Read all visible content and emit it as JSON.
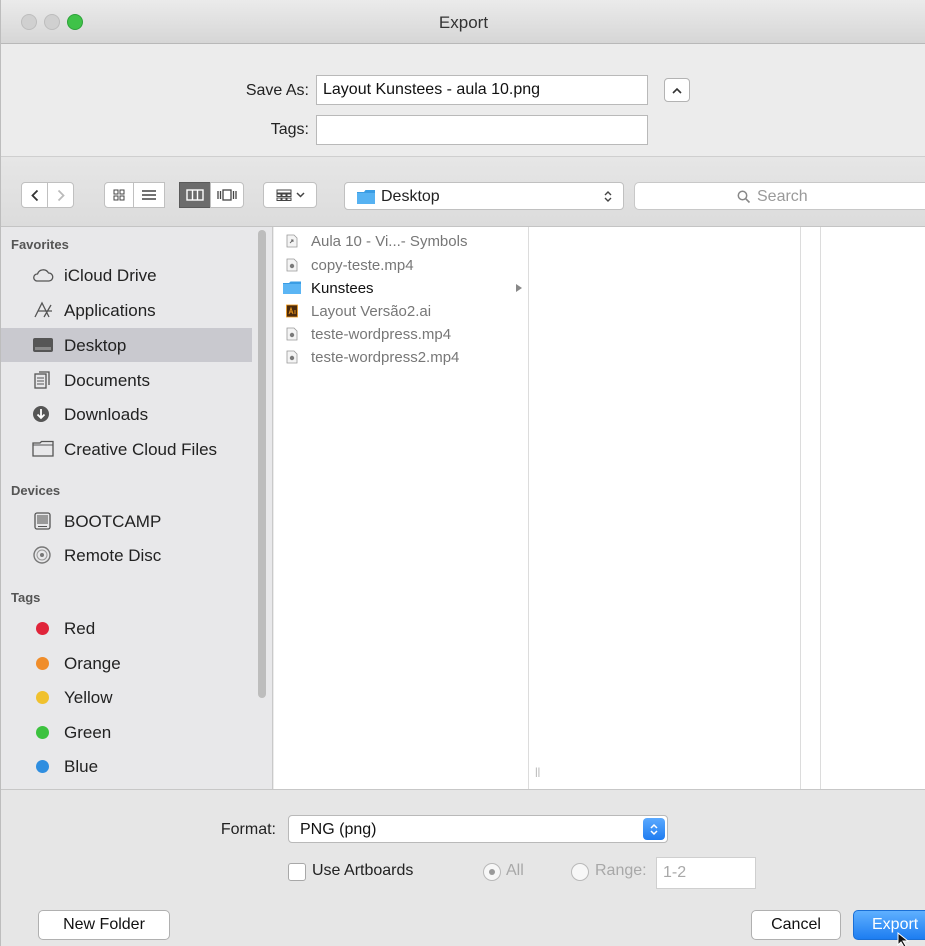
{
  "window": {
    "title": "Export"
  },
  "saveas": {
    "save_as_label": "Save As:",
    "file_name": "Layout Kunstees - aula 10.png",
    "tags_label": "Tags:",
    "tags_value": ""
  },
  "toolbar": {
    "location": "Desktop",
    "search_placeholder": "Search"
  },
  "sidebar": {
    "favorites_header": "Favorites",
    "favorites": [
      {
        "label": "iCloud Drive",
        "icon": "cloud-icon"
      },
      {
        "label": "Applications",
        "icon": "applications-icon"
      },
      {
        "label": "Desktop",
        "icon": "desktop-icon",
        "selected": true
      },
      {
        "label": "Documents",
        "icon": "documents-icon"
      },
      {
        "label": "Downloads",
        "icon": "downloads-icon"
      },
      {
        "label": "Creative Cloud Files",
        "icon": "folder-icon"
      }
    ],
    "devices_header": "Devices",
    "devices": [
      {
        "label": "BOOTCAMP",
        "icon": "drive-icon"
      },
      {
        "label": "Remote Disc",
        "icon": "disc-icon"
      }
    ],
    "tags_header": "Tags",
    "tags": [
      {
        "label": "Red",
        "color": "#e0243a"
      },
      {
        "label": "Orange",
        "color": "#f08d2a"
      },
      {
        "label": "Yellow",
        "color": "#f0c12e"
      },
      {
        "label": "Green",
        "color": "#3cc23f"
      },
      {
        "label": "Blue",
        "color": "#2f8ee0"
      }
    ]
  },
  "files": [
    {
      "name": "Aula 10 - Vi...- Symbols",
      "type": "alias"
    },
    {
      "name": "copy-teste.mp4",
      "type": "video"
    },
    {
      "name": "Kunstees",
      "type": "folder"
    },
    {
      "name": "Layout Versão2.ai",
      "type": "illustrator"
    },
    {
      "name": "teste-wordpress.mp4",
      "type": "video"
    },
    {
      "name": "teste-wordpress2.mp4",
      "type": "video"
    }
  ],
  "footer": {
    "format_label": "Format:",
    "format_value": "PNG (png)",
    "use_artboards_label": "Use Artboards",
    "all_label": "All",
    "range_label": "Range:",
    "range_value": "1-2",
    "new_folder": "New Folder",
    "cancel": "Cancel",
    "export": "Export"
  },
  "colors": {
    "accent": "#1d7df1",
    "selection": "#c9c9cf"
  }
}
